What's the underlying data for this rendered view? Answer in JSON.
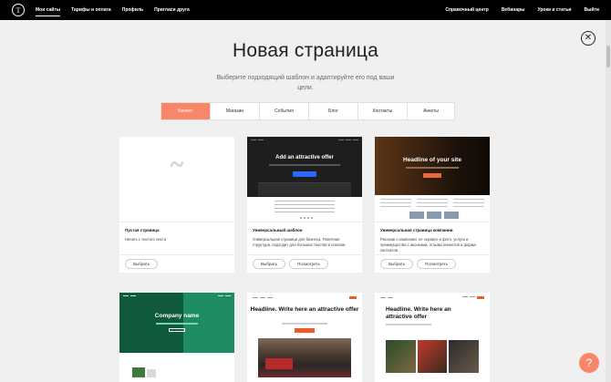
{
  "nav": {
    "left": [
      "Мои сайты",
      "Тарифы и оплата",
      "Профиль",
      "Пригласи друга"
    ],
    "right": [
      "Справочный центр",
      "Вебинары",
      "Уроки и статьи",
      "Выйти"
    ]
  },
  "icons": {
    "logo": "tilda-logo-icon",
    "close": "close-icon",
    "help": "help-icon"
  },
  "header": {
    "title": "Новая страница",
    "subtitle": "Выберите подходящий шаблон и адаптируйте его под ваши цели."
  },
  "tabs": [
    "Бизнес",
    "Магазин",
    "События",
    "Блог",
    "Контакты",
    "Анкеты"
  ],
  "active_tab": "Бизнес",
  "colors": {
    "accent": "#fa8669",
    "topbar": "#000000",
    "background": "#f0f0f0"
  },
  "cards": [
    {
      "title": "Пустая страница",
      "desc": "Начать с чистого листа",
      "select": "Выбрать"
    },
    {
      "title": "Универсальный шаблон",
      "desc": "Универсальная страница для бизнеса. Понятная структура, подходит для больших текстов и списков",
      "select": "Выбрать",
      "preview": "Посмотреть",
      "thumb_text": "Add an attractive offer"
    },
    {
      "title": "Универсальная страница компании",
      "desc": "Расскаж о компании: ее сервисе и фото, услуги и преимущества с иконками, отзывы клиентов и форма контактов",
      "select": "Выбрать",
      "preview": "Посмотреть",
      "thumb_text": "Headline of your site"
    }
  ],
  "cards_row2": [
    {
      "thumb_text": "Company name"
    },
    {
      "thumb_text": "Headline. Write here an attractive offer"
    },
    {
      "thumb_text": "Headline. Write here an attractive offer"
    }
  ],
  "help_label": "?"
}
